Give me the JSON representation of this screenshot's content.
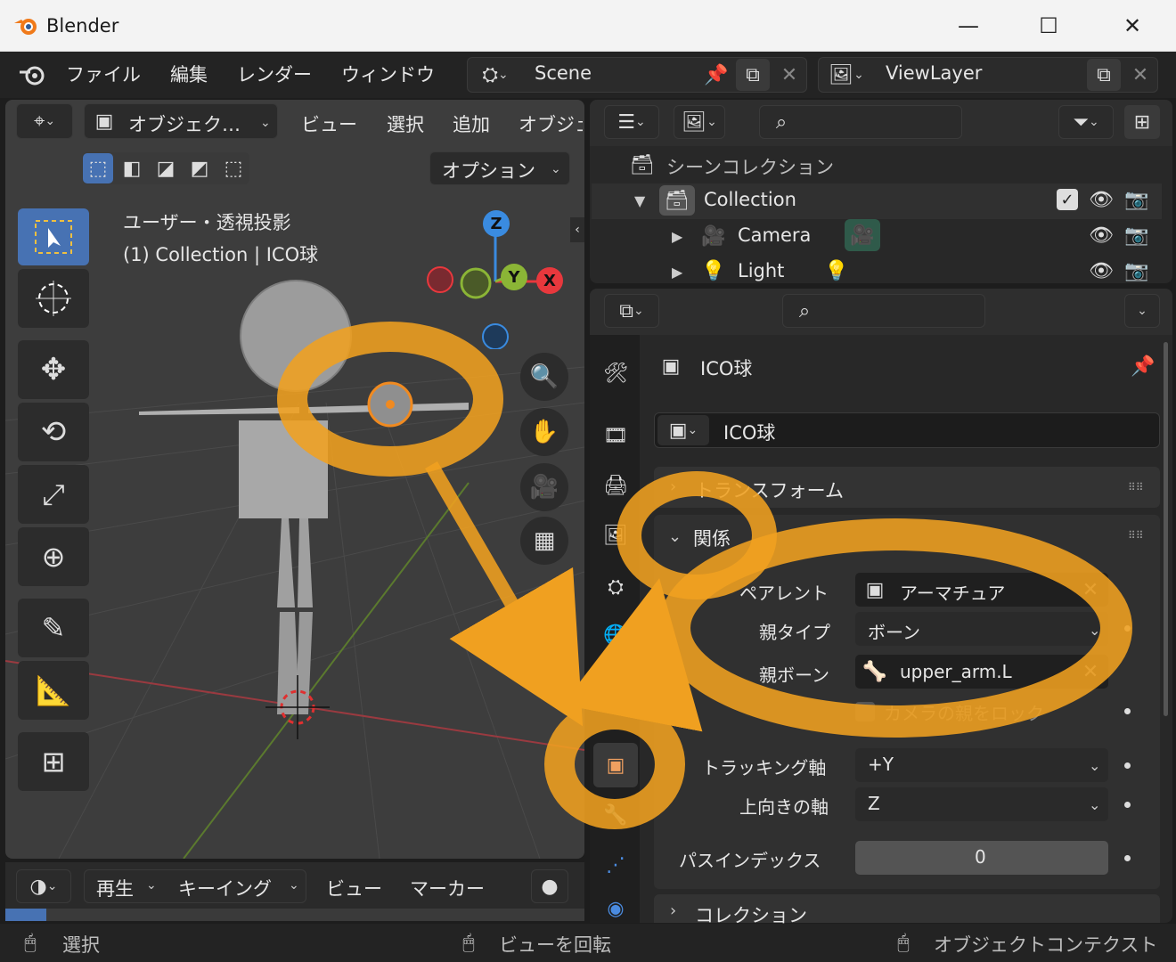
{
  "window": {
    "app_title": "Blender",
    "controls": {
      "minimize": "—",
      "maximize": "☐",
      "close": "✕"
    }
  },
  "topbar": {
    "menus": [
      "ファイル",
      "編集",
      "レンダー",
      "ウィンドウ"
    ],
    "scene": "Scene",
    "view_layer": "ViewLayer"
  },
  "viewport": {
    "header": {
      "mode": "オブジェク…",
      "menus": [
        "ビュー",
        "選択",
        "追加",
        "オブジェ"
      ]
    },
    "options_label": "オプション",
    "overlay_line1": "ユーザー・透視投影",
    "overlay_line2": "(1) Collection | ICO球",
    "gizmo_axes": {
      "z": "Z",
      "y": "Y",
      "x": "X"
    },
    "colors": {
      "x_axis": "#e8383d",
      "y_axis": "#8bb536",
      "z_axis": "#3a8be0",
      "highlight": "#f0a020"
    }
  },
  "timeline": {
    "menus": [
      "再生",
      "キーイング",
      "ビュー",
      "マーカー"
    ]
  },
  "outliner": {
    "items": [
      {
        "label": "シーンコレクション"
      },
      {
        "label": "Collection"
      },
      {
        "label": "Camera"
      },
      {
        "label": "Light"
      }
    ]
  },
  "properties": {
    "object_name": "ICO球",
    "name_field": "ICO球",
    "sections": {
      "transform": "トランスフォーム",
      "relations": "関係",
      "collections": "コレクション"
    },
    "rows": {
      "parent_label": "ペアレント",
      "parent_value": "アーマチュア",
      "parent_type_label": "親タイプ",
      "parent_type_value": "ボーン",
      "parent_bone_label": "親ボーン",
      "parent_bone_value": "upper_arm.L",
      "lock_camera_label": "カメラの親をロック",
      "tracking_axis_label": "トラッキング軸",
      "tracking_axis_value": "+Y",
      "up_axis_label": "上向きの軸",
      "up_axis_value": "Z",
      "pass_index_label": "パスインデックス",
      "pass_index_value": "0"
    }
  },
  "statusbar": {
    "items": [
      "選択",
      "ビューを回転",
      "オブジェクトコンテクスト"
    ]
  }
}
